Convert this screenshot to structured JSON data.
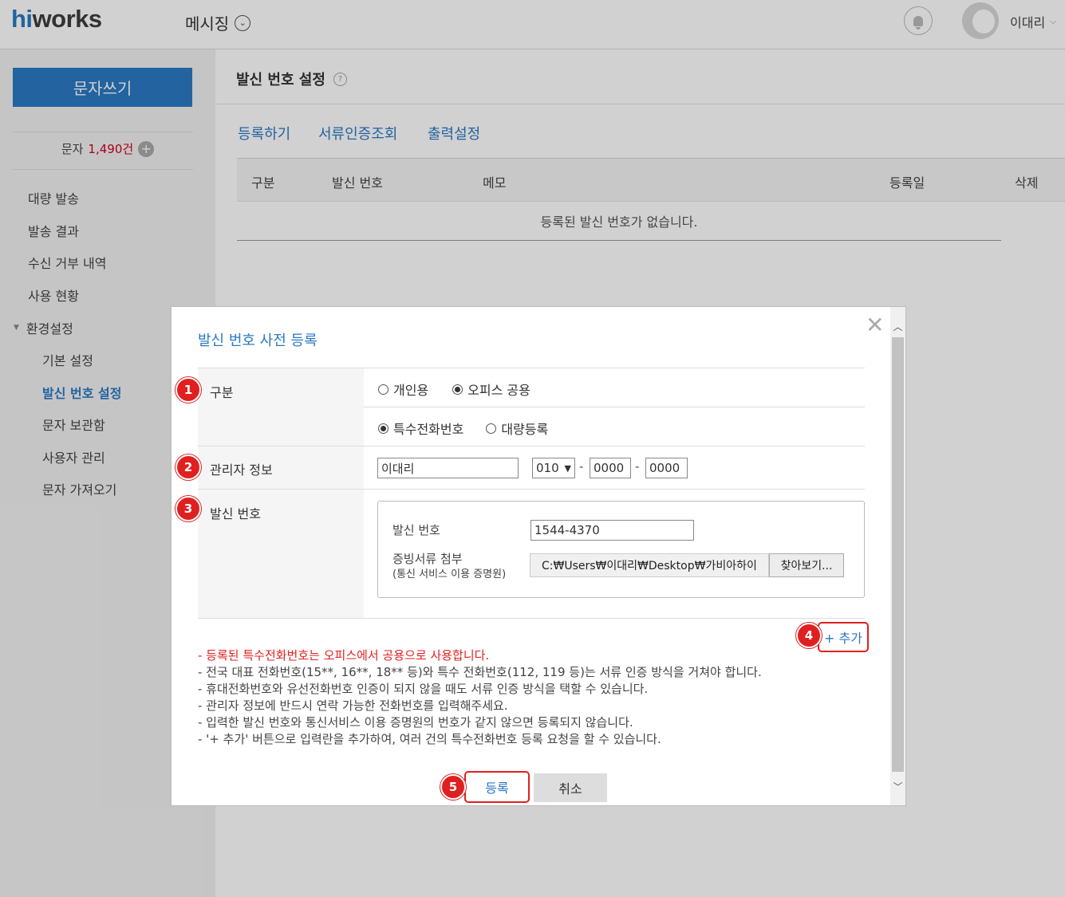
{
  "header": {
    "logo_hi": "hi",
    "logo_rest": "works",
    "app_menu": "메시징",
    "user_name": "이대리"
  },
  "sidebar": {
    "write_button": "문자쓰기",
    "credit_label": "문자",
    "credit_count": "1,490건",
    "items": [
      "대량 발송",
      "발송 결과",
      "수신 거부 내역",
      "사용 현황"
    ],
    "section": "환경설정",
    "sub_items": [
      "기본 설정",
      "발신 번호 설정",
      "문자 보관함",
      "사용자 관리",
      "문자 가져오기"
    ],
    "active_sub": "발신 번호 설정"
  },
  "main": {
    "title": "발신 번호 설정",
    "tabs": [
      "등록하기",
      "서류인증조회",
      "출력설정"
    ],
    "table_headers": [
      "구분",
      "발신 번호",
      "메모",
      "등록일",
      "삭제"
    ],
    "empty_message": "등록된 발신 번호가 없습니다."
  },
  "modal": {
    "title": "발신 번호 사전 등록",
    "badges": [
      "1",
      "2",
      "3",
      "4",
      "5"
    ],
    "type": {
      "label": "구분",
      "options_row1": [
        "개인용",
        "오피스 공용"
      ],
      "selected_row1": "오피스 공용",
      "options_row2": [
        "특수전화번호",
        "대량등록"
      ],
      "selected_row2": "특수전화번호"
    },
    "manager": {
      "label": "관리자 정보",
      "name_value": "이대리",
      "phone_prefix": "010",
      "phone_mid": "0000",
      "phone_last": "0000",
      "separator": "-"
    },
    "sender": {
      "label": "발신 번호",
      "number_label": "발신 번호",
      "number_value": "1544-4370",
      "attach_label": "증빙서류 첨부",
      "attach_sub": "(통신 서비스 이용 증명원)",
      "file_path": "C:₩Users₩이대리₩Desktop₩가비아하이",
      "browse_button": "찾아보기..."
    },
    "add_link": "+ 추가",
    "notes_red": "- 등록된 특수전화번호는 오피스에서 공용으로 사용합니다.",
    "notes": [
      "- 전국 대표 전화번호(15**, 16**, 18** 등)와 특수 전화번호(112, 119 등)는 서류 인증 방식을 거쳐야 합니다.",
      "- 휴대전화번호와 유선전화번호 인증이 되지 않을 때도 서류 인증 방식을 택할 수 있습니다.",
      "- 관리자 정보에 반드시 연락 가능한 전화번호를 입력해주세요.",
      "- 입력한 발신 번호와 통신서비스 이용 증명원의 번호가 같지 않으면 등록되지 않습니다.",
      "- '+ 추가' 버튼으로 입력란을 추가하여, 여러 건의 특수전화번호 등록 요청을 할 수 있습니다."
    ],
    "register_button": "등록",
    "cancel_button": "취소"
  },
  "colors": {
    "accent": "#2a79c4",
    "highlight": "#e02020",
    "sidebar_bg": "#f1f1f1"
  }
}
